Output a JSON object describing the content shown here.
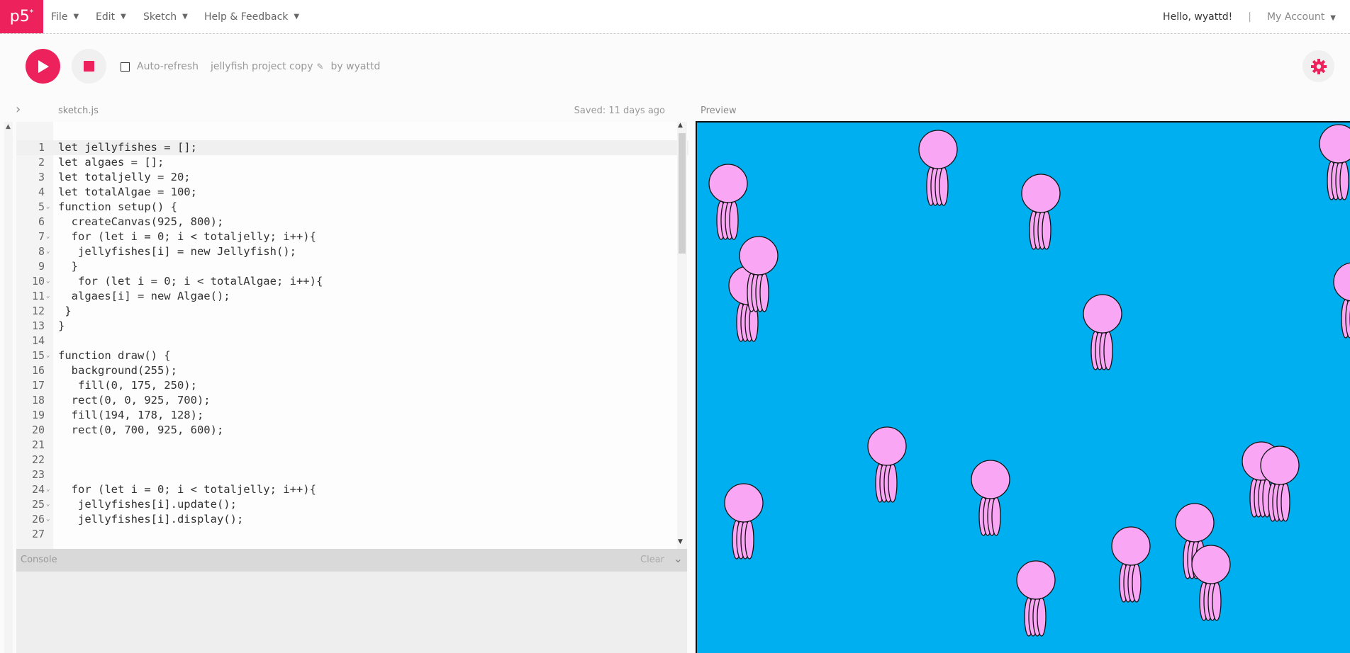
{
  "nav": {
    "logo": "p5",
    "logo_mark": "*",
    "menus": [
      "File",
      "Edit",
      "Sketch",
      "Help & Feedback"
    ],
    "greeting": "Hello, wyattd!",
    "separator": "|",
    "account": "My Account"
  },
  "toolbar": {
    "play_icon": "play-icon",
    "stop_icon": "stop-icon",
    "auto_refresh_label": "Auto-refresh",
    "auto_refresh_checked": false,
    "project_name": "jellyfish project copy",
    "owner": "by wyattd",
    "settings_icon": "gear-icon"
  },
  "editor": {
    "file_name": "sketch.js",
    "saved_status": "Saved: 11 days ago",
    "lines": [
      {
        "n": "1",
        "fold": false,
        "text": "let jellyfishes = [];"
      },
      {
        "n": "2",
        "fold": false,
        "text": "let algaes = [];"
      },
      {
        "n": "3",
        "fold": false,
        "text": "let totaljelly = 20;"
      },
      {
        "n": "4",
        "fold": false,
        "text": "let totalAlgae = 100;"
      },
      {
        "n": "5",
        "fold": true,
        "text": "function setup() {"
      },
      {
        "n": "6",
        "fold": false,
        "text": "  createCanvas(925, 800);"
      },
      {
        "n": "7",
        "fold": true,
        "text": "  for (let i = 0; i < totaljelly; i++){"
      },
      {
        "n": "8",
        "fold": true,
        "text": "   jellyfishes[i] = new Jellyfish();"
      },
      {
        "n": "9",
        "fold": false,
        "text": "  }"
      },
      {
        "n": "10",
        "fold": true,
        "text": "   for (let i = 0; i < totalAlgae; i++){"
      },
      {
        "n": "11",
        "fold": true,
        "text": "  algaes[i] = new Algae();"
      },
      {
        "n": "12",
        "fold": false,
        "text": " }"
      },
      {
        "n": "13",
        "fold": false,
        "text": "}"
      },
      {
        "n": "14",
        "fold": false,
        "text": ""
      },
      {
        "n": "15",
        "fold": true,
        "text": "function draw() {"
      },
      {
        "n": "16",
        "fold": false,
        "text": "  background(255);"
      },
      {
        "n": "17",
        "fold": false,
        "text": "   fill(0, 175, 250);"
      },
      {
        "n": "18",
        "fold": false,
        "text": "  rect(0, 0, 925, 700);"
      },
      {
        "n": "19",
        "fold": false,
        "text": "  fill(194, 178, 128);"
      },
      {
        "n": "20",
        "fold": false,
        "text": "  rect(0, 700, 925, 600);"
      },
      {
        "n": "21",
        "fold": false,
        "text": ""
      },
      {
        "n": "22",
        "fold": false,
        "text": ""
      },
      {
        "n": "23",
        "fold": false,
        "text": ""
      },
      {
        "n": "24",
        "fold": true,
        "text": "  for (let i = 0; i < totaljelly; i++){"
      },
      {
        "n": "25",
        "fold": true,
        "text": "   jellyfishes[i].update();"
      },
      {
        "n": "26",
        "fold": true,
        "text": "   jellyfishes[i].display();"
      },
      {
        "n": "27",
        "fold": false,
        "text": ""
      }
    ]
  },
  "console": {
    "label": "Console",
    "clear_label": "Clear"
  },
  "preview": {
    "label": "Preview",
    "background_color": "#00aff0",
    "jellyfish_color": "#f9a6f5"
  }
}
